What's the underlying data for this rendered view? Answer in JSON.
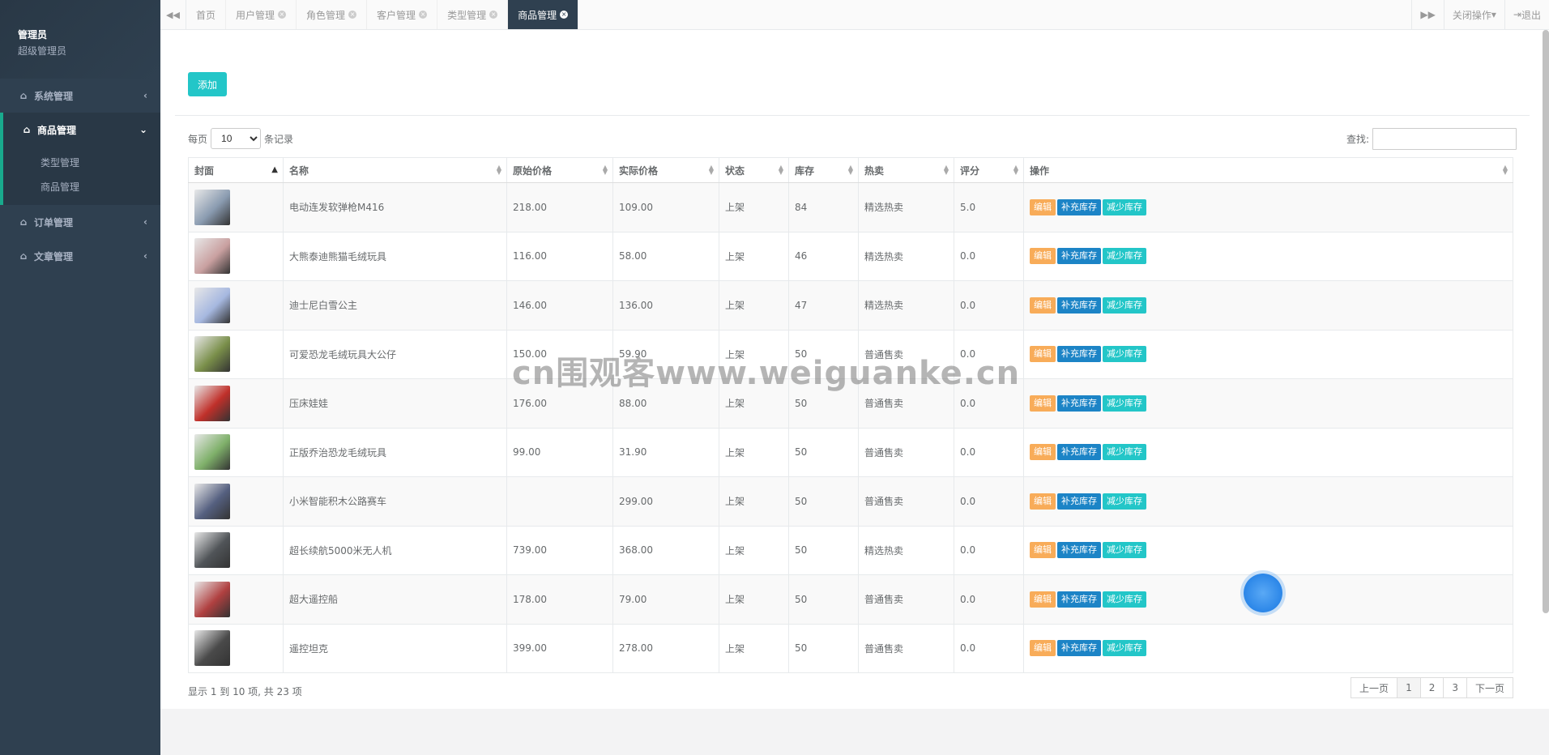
{
  "profile": {
    "name": "管理员",
    "role": "超级管理员"
  },
  "nav": {
    "items": [
      {
        "label": "系统管理",
        "icon": "home-icon"
      },
      {
        "label": "商品管理",
        "icon": "home-icon"
      },
      {
        "label": "订单管理",
        "icon": "home-icon"
      },
      {
        "label": "文章管理",
        "icon": "home-icon"
      }
    ],
    "sub": [
      "类型管理",
      "商品管理"
    ]
  },
  "tabs": [
    "首页",
    "用户管理",
    "角色管理",
    "客户管理",
    "类型管理",
    "商品管理"
  ],
  "tab_right": {
    "close_ops": "关闭操作",
    "logout": "退出"
  },
  "toolbar": {
    "add_label": "添加"
  },
  "length": {
    "prefix": "每页",
    "value": "10",
    "suffix": "条记录"
  },
  "search": {
    "label": "查找:"
  },
  "table": {
    "headers": [
      "封面",
      "名称",
      "原始价格",
      "实际价格",
      "状态",
      "库存",
      "热卖",
      "评分",
      "操作"
    ],
    "rows": [
      {
        "name": "电动连发软弹枪M416",
        "orig": "218.00",
        "real": "109.00",
        "status": "上架",
        "stock": "84",
        "hot": "精选热卖",
        "score": "5.0",
        "color": "#8a9bb0"
      },
      {
        "name": "大熊泰迪熊猫毛绒玩具",
        "orig": "116.00",
        "real": "58.00",
        "status": "上架",
        "stock": "46",
        "hot": "精选热卖",
        "score": "0.0",
        "color": "#c9a0a0"
      },
      {
        "name": "迪士尼白雪公主",
        "orig": "146.00",
        "real": "136.00",
        "status": "上架",
        "stock": "47",
        "hot": "精选热卖",
        "score": "0.0",
        "color": "#a6b8e0"
      },
      {
        "name": "可爱恐龙毛绒玩具大公仔",
        "orig": "150.00",
        "real": "59.90",
        "status": "上架",
        "stock": "50",
        "hot": "普通售卖",
        "score": "0.0",
        "color": "#7a8f4a"
      },
      {
        "name": "压床娃娃",
        "orig": "176.00",
        "real": "88.00",
        "status": "上架",
        "stock": "50",
        "hot": "普通售卖",
        "score": "0.0",
        "color": "#c0302a"
      },
      {
        "name": "正版乔治恐龙毛绒玩具",
        "orig": "99.00",
        "real": "31.90",
        "status": "上架",
        "stock": "50",
        "hot": "普通售卖",
        "score": "0.0",
        "color": "#7fb06a"
      },
      {
        "name": "小米智能积木公路赛车",
        "orig": "",
        "real": "299.00",
        "status": "上架",
        "stock": "50",
        "hot": "普通售卖",
        "score": "0.0",
        "color": "#556080"
      },
      {
        "name": "超长续航5000米无人机",
        "orig": "739.00",
        "real": "368.00",
        "status": "上架",
        "stock": "50",
        "hot": "精选热卖",
        "score": "0.0",
        "color": "#505458"
      },
      {
        "name": "超大遥控船",
        "orig": "178.00",
        "real": "79.00",
        "status": "上架",
        "stock": "50",
        "hot": "普通售卖",
        "score": "0.0",
        "color": "#b04040"
      },
      {
        "name": "遥控坦克",
        "orig": "399.00",
        "real": "278.00",
        "status": "上架",
        "stock": "50",
        "hot": "普通售卖",
        "score": "0.0",
        "color": "#4a4a4a"
      }
    ],
    "ops": [
      "编辑",
      "补充库存",
      "减少库存"
    ]
  },
  "info": "显示 1 到 10 项, 共 23 项",
  "pager": [
    "上一页",
    "1",
    "2",
    "3",
    "下一页"
  ],
  "watermark": "cn围观客www.weiguanke.cn"
}
